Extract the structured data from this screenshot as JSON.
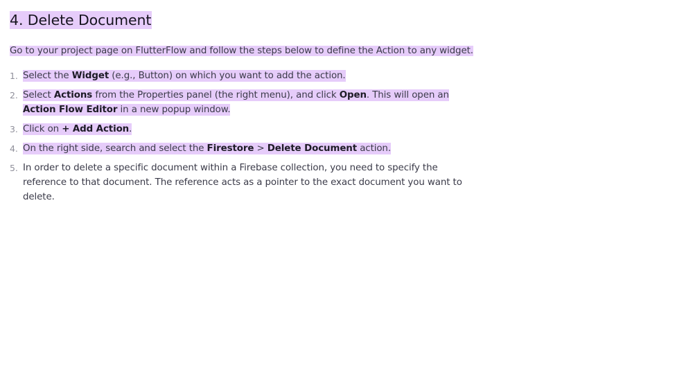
{
  "colors": {
    "highlight": "#e6ccfa",
    "text": "#3a3a48",
    "heading": "#16141f",
    "list_number": "#8f8f9a"
  },
  "heading": "4. Delete Document",
  "intro": "Go to your project page on FlutterFlow and follow the steps below to define the Action to any widget.",
  "steps": [
    {
      "number": "1.",
      "parts": [
        "Select the ",
        "Widget",
        " (e.g., Button) on which you want to add the action."
      ]
    },
    {
      "number": "2.",
      "parts": [
        "Select ",
        "Actions",
        " from the Properties panel (the right menu), and click ",
        "Open",
        ". This will open an ",
        "Action Flow Editor",
        " in a new popup window."
      ]
    },
    {
      "number": "3.",
      "parts": [
        "Click on ",
        "+ Add Action",
        "."
      ]
    },
    {
      "number": "4.",
      "parts": [
        "On the right side, search and select the ",
        "Firestore",
        " > ",
        "Delete Document",
        " action."
      ]
    },
    {
      "number": "5.",
      "parts": [
        "In order to delete a specific document within a Firebase collection, you need to specify the reference to that document. The reference acts as a pointer to the exact document you want to delete."
      ]
    }
  ]
}
